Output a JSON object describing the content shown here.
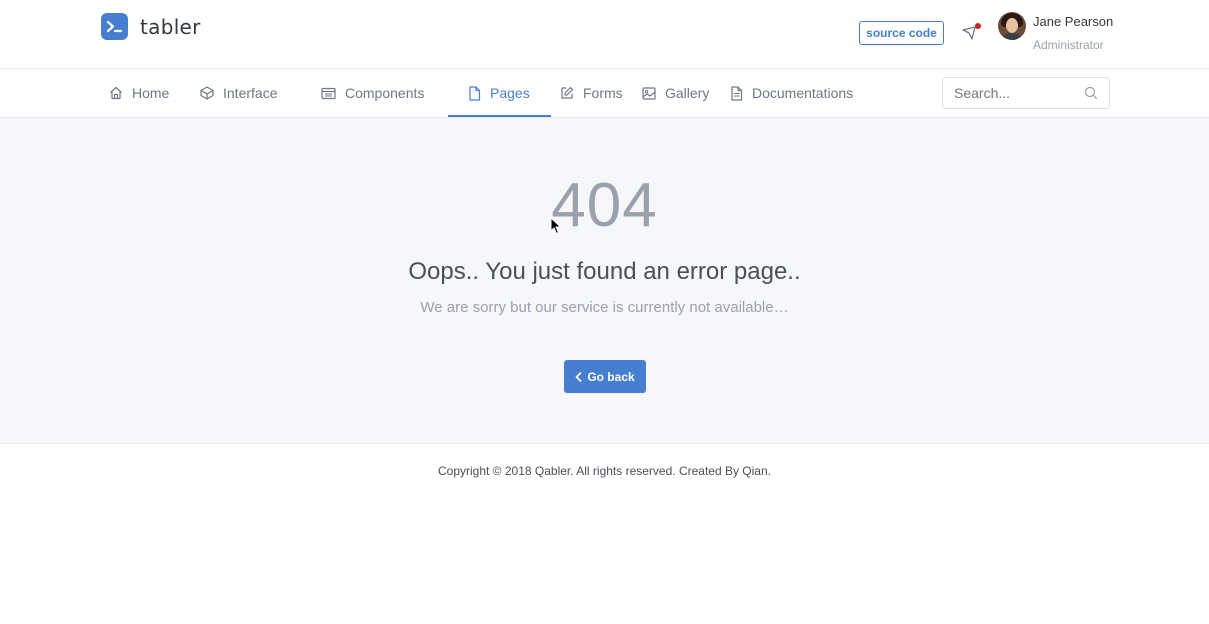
{
  "brand": {
    "name": "tabler",
    "logo_icon": "terminal-icon",
    "accent": "#467fcf"
  },
  "header": {
    "source_code_label": "source code",
    "notification_icon": "bell-icon",
    "user": {
      "name": "Jane Pearson",
      "role": "Administrator"
    }
  },
  "nav": {
    "items": [
      {
        "label": "Home",
        "icon": "home-icon",
        "active": false
      },
      {
        "label": "Interface",
        "icon": "box-icon",
        "active": false
      },
      {
        "label": "Components",
        "icon": "calendar-icon",
        "active": false
      },
      {
        "label": "Pages",
        "icon": "file-icon",
        "active": true
      },
      {
        "label": "Forms",
        "icon": "edit-icon",
        "active": false
      },
      {
        "label": "Gallery",
        "icon": "image-icon",
        "active": false
      },
      {
        "label": "Documentations",
        "icon": "file-text-icon",
        "active": false
      }
    ],
    "search": {
      "placeholder": "Search...",
      "value": ""
    }
  },
  "error": {
    "code": "404",
    "title": "Oops.. You just found an error page..",
    "message": "We are sorry but our service is currently not available…",
    "back_label": "Go back"
  },
  "footer": {
    "text": "Copyright © 2018 Qabler. All rights reserved. Created By Qian."
  },
  "colors": {
    "primary": "#467fcf",
    "danger": "#cd201f",
    "muted": "#9aa0ac",
    "background": "#f5f7fb"
  }
}
